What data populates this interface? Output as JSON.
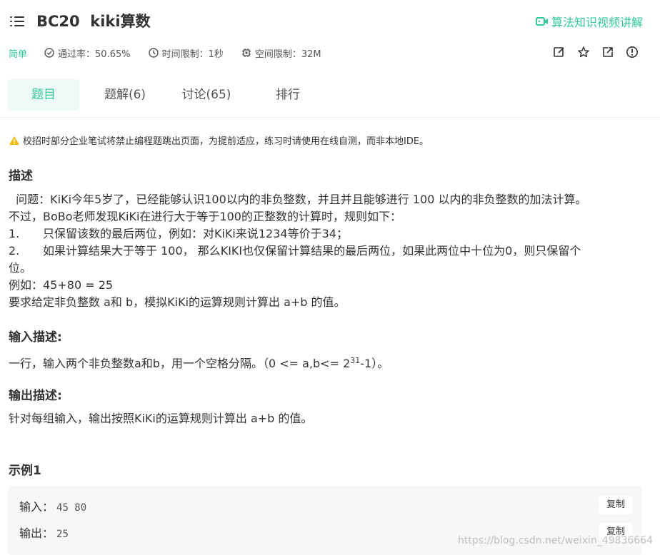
{
  "header": {
    "title": "BC20  kiki算数",
    "video_link": "算法知识视频讲解"
  },
  "meta": {
    "difficulty": "简单",
    "pass_rate": "通过率：50.65%",
    "time_limit": "时间限制：1秒",
    "space_limit": "空间限制：32M"
  },
  "tabs": [
    {
      "label": "题目",
      "active": true
    },
    {
      "label": "题解(6)",
      "active": false
    },
    {
      "label": "讨论(65)",
      "active": false
    },
    {
      "label": "排行",
      "active": false
    }
  ],
  "warning": "校招时部分企业笔试将禁止编程题跳出页面，为提前适应，练习时请使用在线自测，而非本地IDE。",
  "description": {
    "heading": "描述",
    "line1": "  问题：KiKi今年5岁了，已经能够认识100以内的非负整数，并且并且能够进行 100 以内的非负整数的加法计算。",
    "line2": "不过，BoBo老师发现KiKi在进行大于等于100的正整数的计算时，规则如下：",
    "item1_num": "1.",
    "item1_text": "只保留该数的最后两位，例如：对KiKi来说1234等价于34；",
    "item2_num": "2.",
    "item2_text": "如果计算结果大于等于 100， 那么KIKI也仅保留计算结果的最后两位，如果此两位中十位为0，则只保留个",
    "item2_cont": "位。",
    "example": "例如：45+80 = 25",
    "request": "要求给定非负整数 a和 b，模拟KiKi的运算规则计算出 a+b 的值。"
  },
  "input_desc": {
    "heading": "输入描述:",
    "text_before": "一行，输入两个非负整数a和b，用一个空格分隔。（0 <= a,b<= 2",
    "sup": "31",
    "text_after": "-1）。"
  },
  "output_desc": {
    "heading": "输出描述:",
    "text": "针对每组输入，输出按照KiKi的运算规则计算出 a+b 的值。"
  },
  "example1": {
    "heading": "示例1",
    "input_label": "输入：",
    "input_value": "45 80",
    "output_label": "输出：",
    "output_value": "25",
    "copy_label": "复制"
  },
  "watermark": "https://blog.csdn.net/weixin_49836664",
  "colors": {
    "accent": "#32ca99",
    "warning": "#f5b800"
  }
}
